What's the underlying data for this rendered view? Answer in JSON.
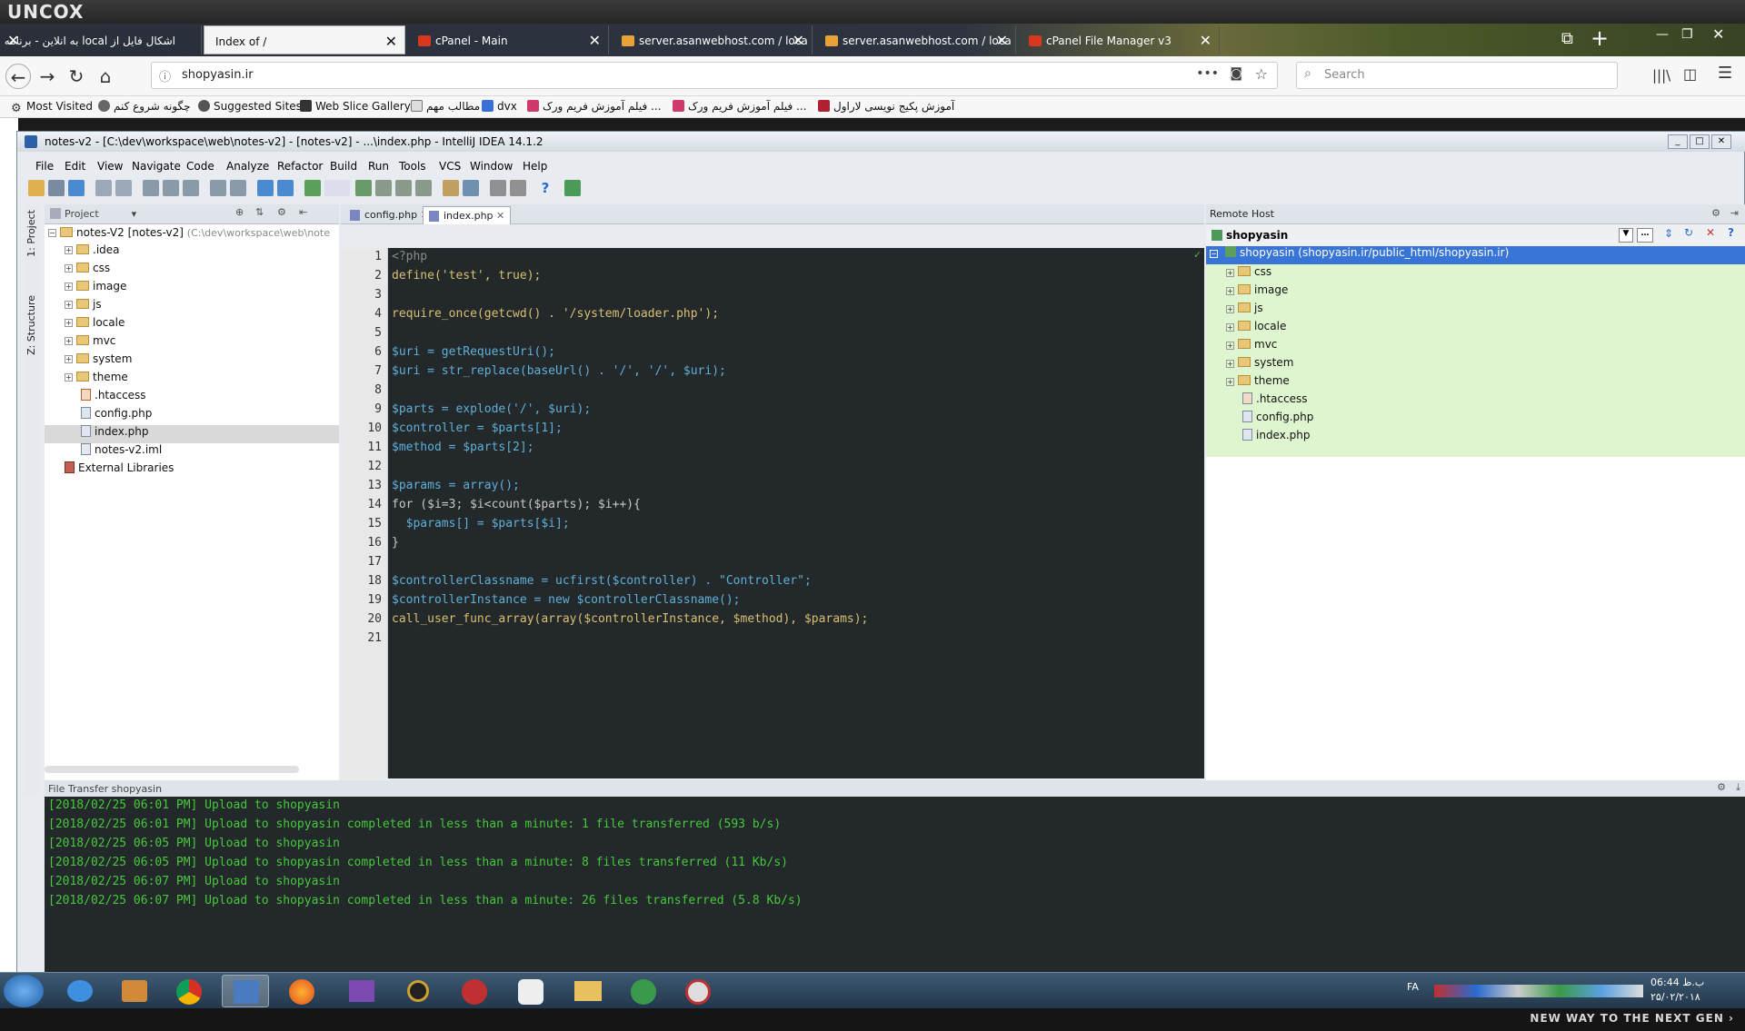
{
  "brand": "UNCOX",
  "browser": {
    "tabs": [
      {
        "label": "اشکال فایل از local به انلاین - برنامه نو",
        "active": false
      },
      {
        "label": "Index of /",
        "active": true
      },
      {
        "label": "cPanel - Main",
        "active": false
      },
      {
        "label": "server.asanwebhost.com / loca",
        "active": false
      },
      {
        "label": "server.asanwebhost.com / loca",
        "active": false
      },
      {
        "label": "cPanel File Manager v3",
        "active": false
      }
    ],
    "url": "shopyasin.ir",
    "search_placeholder": "Search",
    "bookmarks": [
      "Most Visited",
      "چگونه شروع کنم",
      "Suggested Sites",
      "Web Slice Gallery",
      "مطالب مهم",
      "dvx",
      "فیلم آموزش فریم ورک ...",
      "فیلم آموزش فریم ورک ...",
      "آموزش پکیج نویسی لاراول"
    ]
  },
  "ide": {
    "title": "notes-v2 - [C:\\dev\\workspace\\web\\notes-v2] - [notes-v2] - ...\\index.php - IntelliJ IDEA 14.1.2",
    "menu": [
      "File",
      "Edit",
      "View",
      "Navigate",
      "Code",
      "Analyze",
      "Refactor",
      "Build",
      "Run",
      "Tools",
      "VCS",
      "Window",
      "Help"
    ],
    "side_tabs": [
      "1: Project",
      "Z: Structure"
    ],
    "project_pane_label": "Project",
    "project_root": "notes-V2 [notes-v2]",
    "project_root_path": "(C:\\dev\\workspace\\web\\note",
    "project_items": [
      {
        "label": ".idea",
        "type": "folder"
      },
      {
        "label": "css",
        "type": "folder"
      },
      {
        "label": "image",
        "type": "folder"
      },
      {
        "label": "js",
        "type": "folder"
      },
      {
        "label": "locale",
        "type": "folder"
      },
      {
        "label": "mvc",
        "type": "folder"
      },
      {
        "label": "system",
        "type": "folder"
      },
      {
        "label": "theme",
        "type": "folder"
      },
      {
        "label": ".htaccess",
        "type": "file"
      },
      {
        "label": "config.php",
        "type": "file"
      },
      {
        "label": "index.php",
        "type": "file",
        "selected": true
      },
      {
        "label": "notes-v2.iml",
        "type": "file"
      }
    ],
    "external_libraries": "External Libraries",
    "editor_tabs": [
      {
        "label": "config.php",
        "active": false
      },
      {
        "label": "index.php",
        "active": true
      }
    ],
    "line_numbers": [
      "1",
      "2",
      "3",
      "4",
      "5",
      "6",
      "7",
      "8",
      "9",
      "10",
      "11",
      "12",
      "13",
      "14",
      "15",
      "16",
      "17",
      "18",
      "19",
      "20",
      "21"
    ],
    "code_lines": [
      "<?php",
      "define('test', true);",
      "",
      "require_once(getcwd() . '/system/loader.php');",
      "",
      "$uri = getRequestUri();",
      "$uri = str_replace(baseUrl() . '/', '/', $uri);",
      "",
      "$parts = explode('/', $uri);",
      "$controller = $parts[1];",
      "$method = $parts[2];",
      "",
      "$params = array();",
      "for ($i=3; $i<count($parts); $i++){",
      "  $params[] = $parts[$i];",
      "}",
      "",
      "$controllerClassname = ucfirst($controller) . \"Controller\";",
      "$controllerInstance = new $controllerClassname();",
      "call_user_func_array(array($controllerInstance, $method), $params);",
      ""
    ],
    "remote_host_label": "Remote Host",
    "remote_host_name": "shopyasin",
    "remote_root": "shopyasin (shopyasin.ir/public_html/shopyasin.ir)",
    "remote_items": [
      {
        "label": "css",
        "type": "folder"
      },
      {
        "label": "image",
        "type": "folder"
      },
      {
        "label": "js",
        "type": "folder"
      },
      {
        "label": "locale",
        "type": "folder"
      },
      {
        "label": "mvc",
        "type": "folder"
      },
      {
        "label": "system",
        "type": "folder"
      },
      {
        "label": "theme",
        "type": "folder"
      },
      {
        "label": ".htaccess",
        "type": "file"
      },
      {
        "label": "config.php",
        "type": "file"
      },
      {
        "label": "index.php",
        "type": "file"
      }
    ],
    "file_transfer_label": "File Transfer  shopyasin",
    "log_lines": [
      "[2018/02/25 06:01 PM] Upload to shopyasin",
      "[2018/02/25 06:01 PM] Upload to shopyasin completed in less than a minute: 1 file transferred (593 b/s)",
      "[2018/02/25 06:05 PM] Upload to shopyasin",
      "[2018/02/25 06:05 PM] Upload to shopyasin completed in less than a minute: 8 files transferred (11 Kb/s)",
      "[2018/02/25 06:07 PM] Upload to shopyasin",
      "[2018/02/25 06:07 PM] Upload to shopyasin completed in less than a minute: 26 files transferred (5.8 Kb/s)"
    ]
  },
  "taskbar": {
    "lang": "FA",
    "time": "06:44 ب.ظ",
    "date": "۲۵/۰۲/۲۰۱۸"
  },
  "bottom_slogan": "NEW WAY TO THE NEXT GEN ›",
  "colors": {
    "code_bg": "#23282b",
    "log_green": "#46c93a",
    "selection_blue": "#3875d7",
    "remote_bg": "#dff5cf"
  }
}
